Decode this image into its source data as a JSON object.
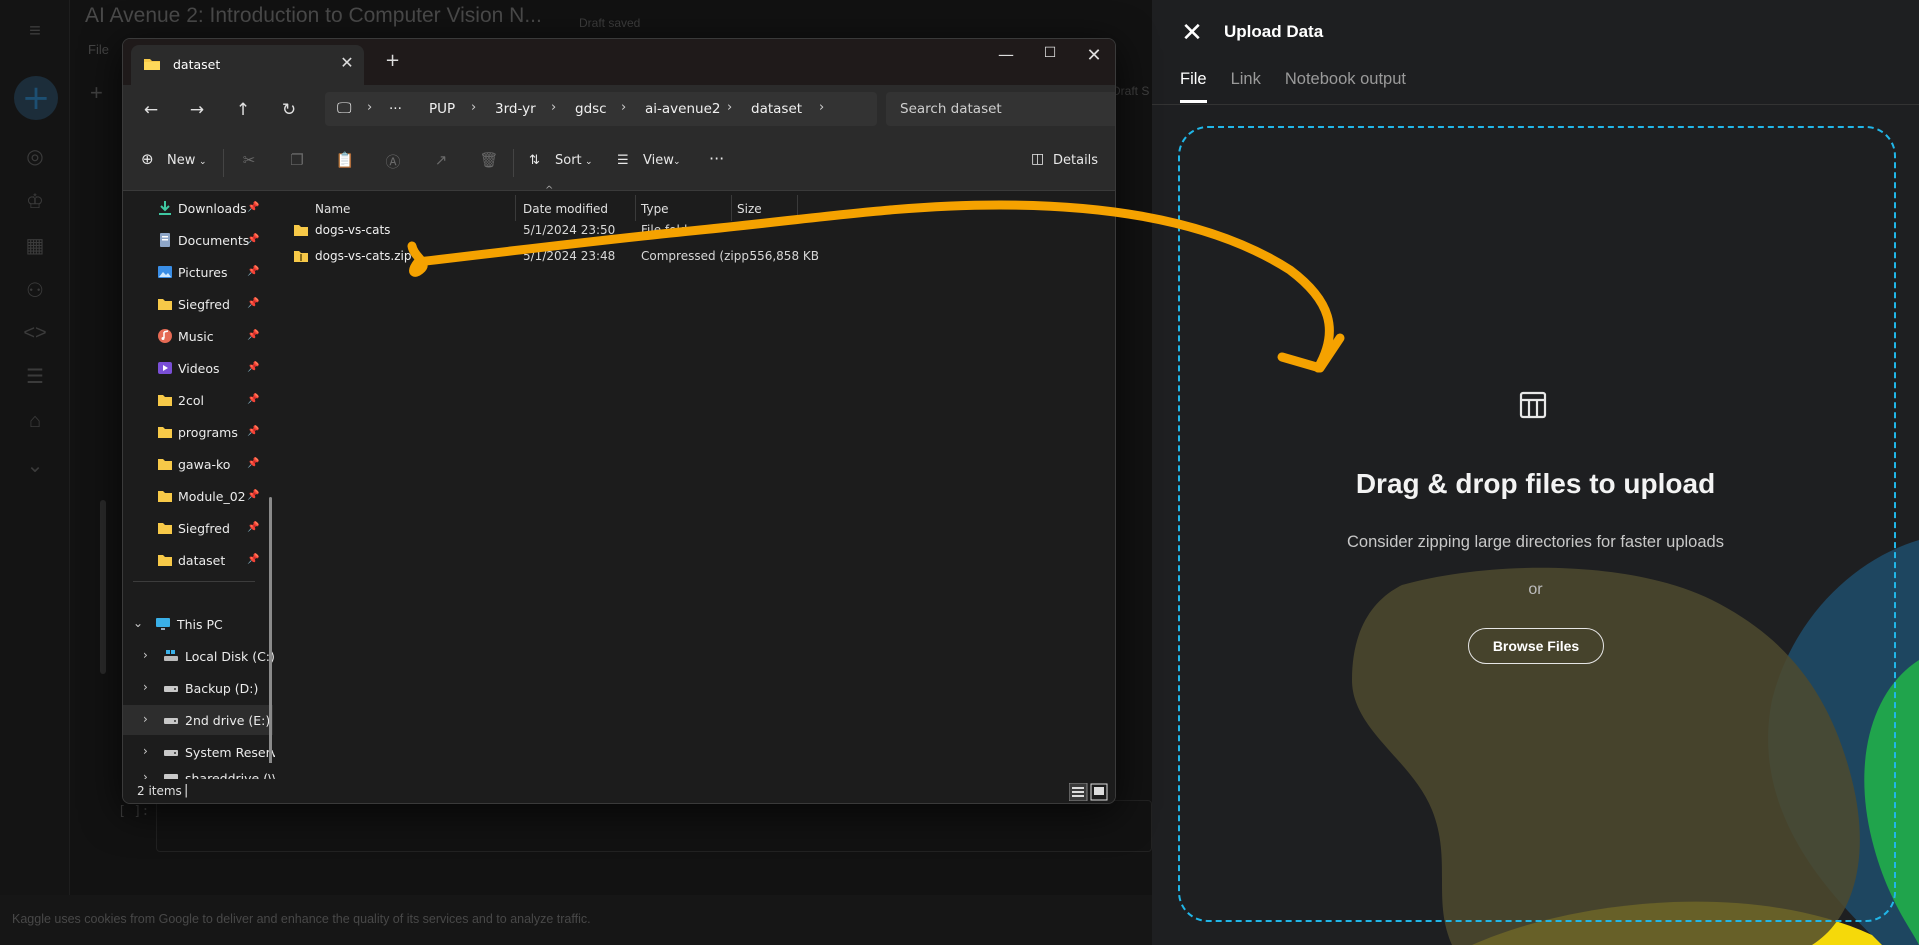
{
  "kaggle": {
    "notebook_title": "AI Avenue 2: Introduction to Computer Vision N...",
    "draft_status": "Draft saved",
    "draft_status_short": "Draft S",
    "menu_file": "File",
    "cell_prompt": "[ ]:",
    "cookie_notice": "Kaggle uses cookies from Google to deliver and enhance the quality of its services and to analyze traffic."
  },
  "upload": {
    "title": "Upload Data",
    "tabs": [
      {
        "label": "File",
        "active": true
      },
      {
        "label": "Link",
        "active": false
      },
      {
        "label": "Notebook output",
        "active": false
      }
    ],
    "drop_title": "Drag & drop files to upload",
    "drop_hint": "Consider zipping large directories for faster uploads",
    "or_text": "or",
    "browse_label": "Browse Files",
    "accent_color": "#20b6e8"
  },
  "explorer": {
    "tab_label": "dataset",
    "breadcrumbs": [
      "PUP",
      "3rd-yr",
      "gdsc",
      "ai-avenue2",
      "dataset"
    ],
    "search_placeholder": "Search dataset",
    "commands": {
      "new": "New",
      "sort": "Sort",
      "view": "View",
      "details": "Details"
    },
    "quick_access": [
      {
        "label": "Downloads",
        "icon": "download-icon"
      },
      {
        "label": "Documents",
        "icon": "documents-icon"
      },
      {
        "label": "Pictures",
        "icon": "pictures-icon"
      },
      {
        "label": "Siegfred",
        "icon": "folder-icon"
      },
      {
        "label": "Music",
        "icon": "music-icon"
      },
      {
        "label": "Videos",
        "icon": "videos-icon"
      },
      {
        "label": "2col",
        "icon": "folder-icon"
      },
      {
        "label": "programs",
        "icon": "folder-icon"
      },
      {
        "label": "gawa-ko",
        "icon": "folder-icon"
      },
      {
        "label": "Module_02",
        "icon": "folder-icon"
      },
      {
        "label": "Siegfred",
        "icon": "folder-icon"
      },
      {
        "label": "dataset",
        "icon": "folder-icon"
      }
    ],
    "this_pc": {
      "label": "This PC",
      "drives": [
        {
          "label": "Local Disk (C:)",
          "selected": false
        },
        {
          "label": "Backup (D:)",
          "selected": false
        },
        {
          "label": "2nd drive (E:)",
          "selected": true
        },
        {
          "label": "System Reserv",
          "selected": false
        },
        {
          "label": "shareddrive (\\\\",
          "selected": false
        }
      ]
    },
    "columns": [
      "Name",
      "Date modified",
      "Type",
      "Size"
    ],
    "files": [
      {
        "name": "dogs-vs-cats",
        "date": "5/1/2024 23:50",
        "type": "File folder",
        "size": "",
        "icon": "folder-icon"
      },
      {
        "name": "dogs-vs-cats.zip",
        "date": "5/1/2024 23:48",
        "type": "Compressed (zipp...",
        "size": "556,858 KB",
        "icon": "zip-folder-icon"
      }
    ],
    "status": "2 items"
  },
  "annotation": {
    "arrow_color": "#f5a200"
  }
}
